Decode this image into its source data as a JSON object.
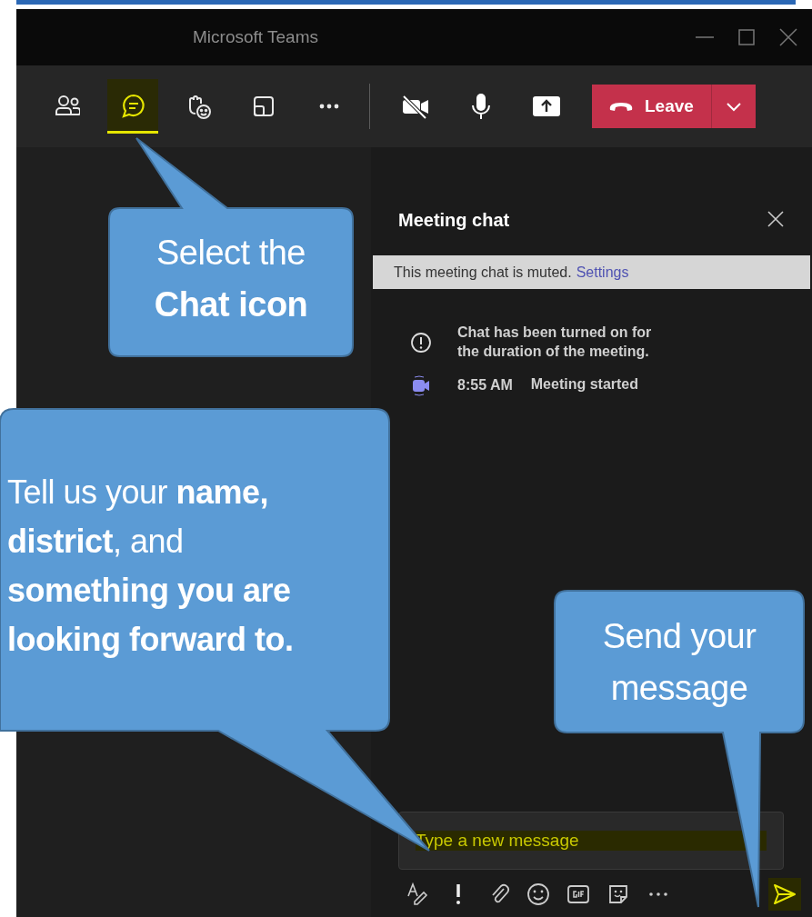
{
  "window": {
    "title": "Microsoft Teams"
  },
  "toolbar": {
    "tabs": [
      {
        "kind": "participants",
        "selected": false
      },
      {
        "kind": "chat",
        "selected": true
      },
      {
        "kind": "reactions",
        "selected": false
      },
      {
        "kind": "rooms",
        "selected": false
      },
      {
        "kind": "more",
        "selected": false
      }
    ],
    "leave_button": {
      "label": "Leave"
    }
  },
  "chat": {
    "title": "Meeting chat",
    "banner": {
      "text": "This meeting chat is muted.",
      "link": "Settings"
    },
    "messages": [
      {
        "kind": "info",
        "text": "Chat has been turned on for\nthe duration of the meeting."
      },
      {
        "kind": "event",
        "time": "8:55 AM",
        "text": "Meeting started"
      }
    ],
    "compose": {
      "placeholder": "Type a new message",
      "highlighted": true
    },
    "send_highlighted": true
  },
  "callouts": [
    {
      "text": "Select the\n**Chat icon**"
    },
    {
      "text": "Tell us your **name,**\n**district**, and\n**something you are**\n**looking forward to.**"
    },
    {
      "text": "Send your\nmessage"
    }
  ]
}
